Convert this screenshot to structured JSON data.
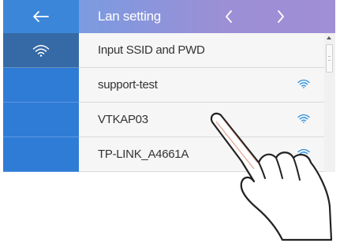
{
  "header": {
    "title": "Lan setting",
    "back_icon": "arrow-left-icon",
    "prev_icon": "chevron-left-icon",
    "next_icon": "chevron-right-icon"
  },
  "sidebar": {
    "items": [
      {
        "icon": "wifi-icon",
        "active": true
      }
    ]
  },
  "list": {
    "rows": [
      {
        "label": "Input SSID and PWD"
      },
      {
        "label": "support-test",
        "icon": "wifi-signal-icon"
      },
      {
        "label": "VTKAP03",
        "icon": "wifi-signal-icon"
      },
      {
        "label": "TP-LINK_A4661A",
        "icon": "wifi-signal-icon"
      }
    ]
  },
  "colors": {
    "header_blue": "#3b86d9",
    "header_gradient_start": "#7b9be0",
    "header_gradient_end": "#a08ed6",
    "sidebar_blue": "#2f7cd6",
    "sidebar_active": "#356aa6",
    "wifi_icon": "#2a8fe0"
  },
  "overlay": {
    "icon": "pointing-hand-icon"
  }
}
